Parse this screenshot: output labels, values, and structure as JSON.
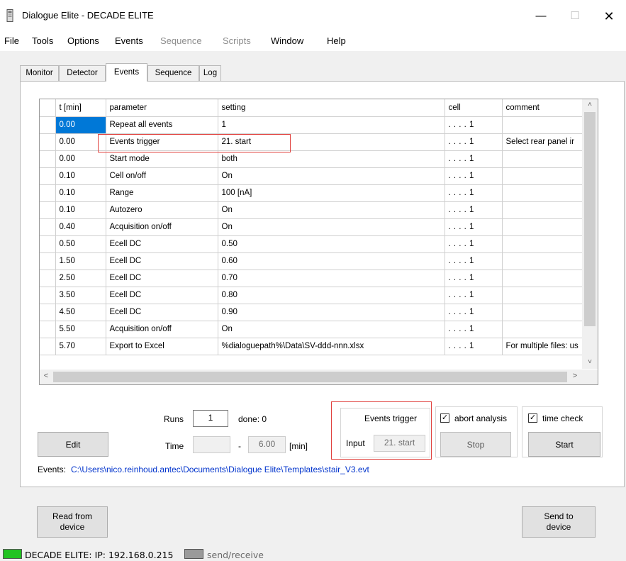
{
  "window": {
    "title": "Dialogue Elite - DECADE ELITE",
    "minimize_glyph": "—",
    "maximize_glyph": "☐",
    "close_glyph": "✕"
  },
  "menu": [
    "File",
    "Tools",
    "Options",
    "Events",
    "Sequence",
    "Scripts",
    "Window",
    "Help"
  ],
  "tabs": [
    "Monitor",
    "Detector",
    "Events",
    "Sequence",
    "Log"
  ],
  "active_tab": "Events",
  "grid": {
    "columns": [
      "t [min]",
      "parameter",
      "setting",
      "cell",
      "comment"
    ],
    "rows": [
      {
        "t": "0.00",
        "parameter": "Repeat all events",
        "setting": "1",
        "cell": ". . . . 1",
        "comment": ""
      },
      {
        "t": "0.00",
        "parameter": "Events trigger",
        "setting": "21. start",
        "cell": ". . . . 1",
        "comment": "Select rear panel ir"
      },
      {
        "t": "0.00",
        "parameter": "Start mode",
        "setting": "both",
        "cell": ". . . . 1",
        "comment": ""
      },
      {
        "t": "0.10",
        "parameter": "Cell on/off",
        "setting": "On",
        "cell": ". . . . 1",
        "comment": ""
      },
      {
        "t": "0.10",
        "parameter": "Range",
        "setting": "100 [nA]",
        "cell": ". . . . 1",
        "comment": ""
      },
      {
        "t": "0.10",
        "parameter": "Autozero",
        "setting": "On",
        "cell": ". . . . 1",
        "comment": ""
      },
      {
        "t": "0.40",
        "parameter": "Acquisition on/off",
        "setting": "On",
        "cell": ". . . . 1",
        "comment": ""
      },
      {
        "t": "0.50",
        "parameter": "Ecell DC",
        "setting": "0.50",
        "cell": ". . . . 1",
        "comment": ""
      },
      {
        "t": "1.50",
        "parameter": "Ecell DC",
        "setting": "0.60",
        "cell": ". . . . 1",
        "comment": ""
      },
      {
        "t": "2.50",
        "parameter": "Ecell DC",
        "setting": "0.70",
        "cell": ". . . . 1",
        "comment": ""
      },
      {
        "t": "3.50",
        "parameter": "Ecell DC",
        "setting": "0.80",
        "cell": ". . . . 1",
        "comment": ""
      },
      {
        "t": "4.50",
        "parameter": "Ecell DC",
        "setting": "0.90",
        "cell": ". . . . 1",
        "comment": ""
      },
      {
        "t": "5.50",
        "parameter": "Acquisition on/off",
        "setting": "On",
        "cell": ". . . . 1",
        "comment": ""
      },
      {
        "t": "5.70",
        "parameter": "Export to Excel",
        "setting": "%dialoguepath%\\Data\\SV-ddd-nnn.xlsx",
        "cell": ". . . . 1",
        "comment": "For multiple files: us"
      }
    ],
    "selected_row": 0,
    "scroll_up": "˄",
    "scroll_down": "˅",
    "scroll_left": "<",
    "scroll_right": ">"
  },
  "controls": {
    "edit": "Edit",
    "runs_label": "Runs",
    "runs_value": "1",
    "done_label": "done: 0",
    "time_label": "Time",
    "time_start": "",
    "time_sep": "-",
    "time_end": "6.00",
    "time_unit": "[min]",
    "events_trigger_label": "Events trigger",
    "input_label": "Input",
    "input_value": "21. start",
    "abort_analysis_label": "abort analysis",
    "abort_analysis_checked": true,
    "stop": "Stop",
    "time_check_label": "time check",
    "time_check_checked": true,
    "start": "Start",
    "check_glyph": "✓",
    "events_file_label": "Events:",
    "events_file_path": "C:\\Users\\nico.reinhoud.antec\\Documents\\Dialogue Elite\\Templates\\stair_V3.evt",
    "read_from_device_line1": "Read from",
    "read_from_device_line2": "device",
    "send_to_device_line1": "Send to",
    "send_to_device_line2": "device"
  },
  "status": {
    "connection": "DECADE ELITE:  IP: 192.168.0.215",
    "send_receive": "send/receive"
  },
  "colors": {
    "selection": "#0078d7",
    "highlight_box": "#e0413e",
    "connected_led": "#22c322",
    "idle_led": "#9a9a9a",
    "link_text": "#0033cc"
  }
}
